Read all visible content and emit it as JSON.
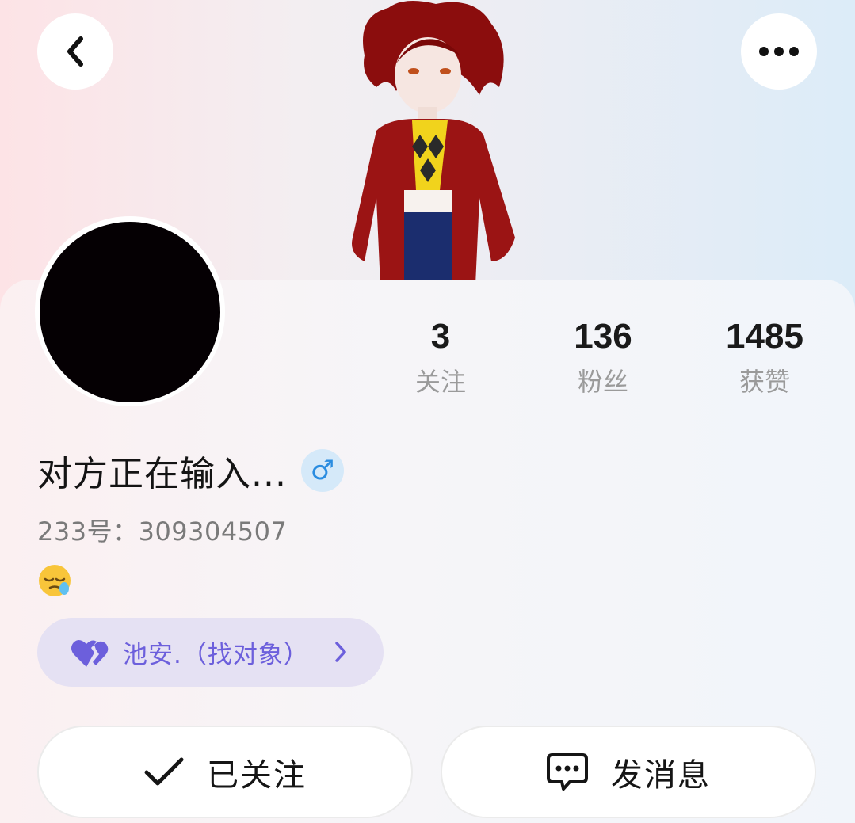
{
  "header": {
    "back_icon": "chevron-left-icon",
    "more_icon": "more-dots-icon"
  },
  "profile": {
    "name": "对方正在输入...",
    "gender_symbol": "♂",
    "uid_text": "233号：309304507",
    "bio_emoji": "sleepy-face-emoji"
  },
  "stats": [
    {
      "value": "3",
      "label": "关注"
    },
    {
      "value": "136",
      "label": "粉丝"
    },
    {
      "value": "1485",
      "label": "获赞"
    }
  ],
  "cp_tag": {
    "text": "池安.（找对象）",
    "icon": "heart-icon",
    "color": "#6c5fdc"
  },
  "actions": {
    "follow_label": "已关注",
    "message_label": "发消息"
  },
  "colors": {
    "accent": "#6c5fdc",
    "gender": "#2a8ce0"
  }
}
